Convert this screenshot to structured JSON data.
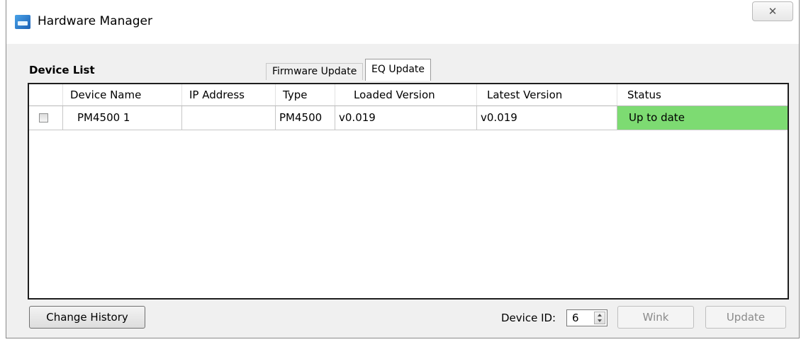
{
  "window": {
    "title": "Hardware Manager",
    "close_glyph": "✕"
  },
  "device_list": {
    "label": "Device List"
  },
  "tabs": [
    {
      "label": "Firmware Update",
      "active": false
    },
    {
      "label": "EQ Update",
      "active": true
    }
  ],
  "table": {
    "headers": [
      "Device Name",
      "IP Address",
      "Type",
      "Loaded Version",
      "Latest Version",
      "Status"
    ],
    "rows": [
      {
        "checked": false,
        "device_name": "PM4500 1",
        "ip_address": "",
        "type": "PM4500",
        "loaded_version": "v0.019",
        "latest_version": "v0.019",
        "status": "Up to date",
        "status_color": "#7ddb72"
      }
    ]
  },
  "footer": {
    "change_history_label": "Change History",
    "device_id_label": "Device ID:",
    "device_id_value": "6",
    "wink_label": "Wink",
    "update_label": "Update"
  }
}
